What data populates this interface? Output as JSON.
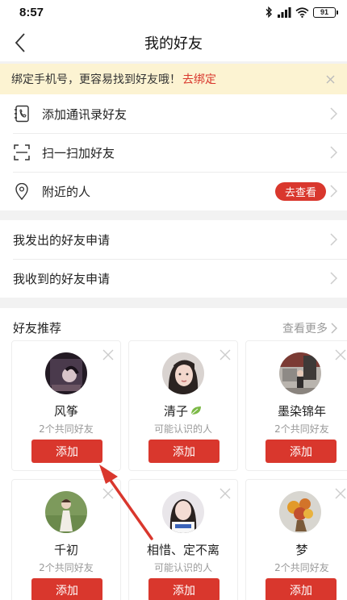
{
  "status_bar": {
    "time": "8:57",
    "battery": "91"
  },
  "nav": {
    "title": "我的好友"
  },
  "banner": {
    "text": "绑定手机号，更容易找到好友哦！",
    "link": "去绑定"
  },
  "menu": {
    "contacts": "添加通讯录好友",
    "scan": "扫一扫加好友",
    "nearby": "附近的人",
    "nearby_button": "去查看"
  },
  "requests": {
    "sent": "我发出的好友申请",
    "received": "我收到的好友申请"
  },
  "recommend": {
    "title": "好友推荐",
    "more": "查看更多",
    "add_label": "添加",
    "cards": [
      {
        "name": "风筝",
        "sub": "2个共同好友"
      },
      {
        "name": "清子",
        "sub": "可能认识的人"
      },
      {
        "name": "墨染锦年",
        "sub": "2个共同好友"
      },
      {
        "name": "千初",
        "sub": "2个共同好友"
      },
      {
        "name": "相惜、定不离",
        "sub": "可能认识的人"
      },
      {
        "name": "梦",
        "sub": "2个共同好友"
      }
    ]
  },
  "colors": {
    "accent": "#d9372d",
    "banner_bg": "#fcf3d2",
    "annotation_arrow": "#d9372d"
  }
}
